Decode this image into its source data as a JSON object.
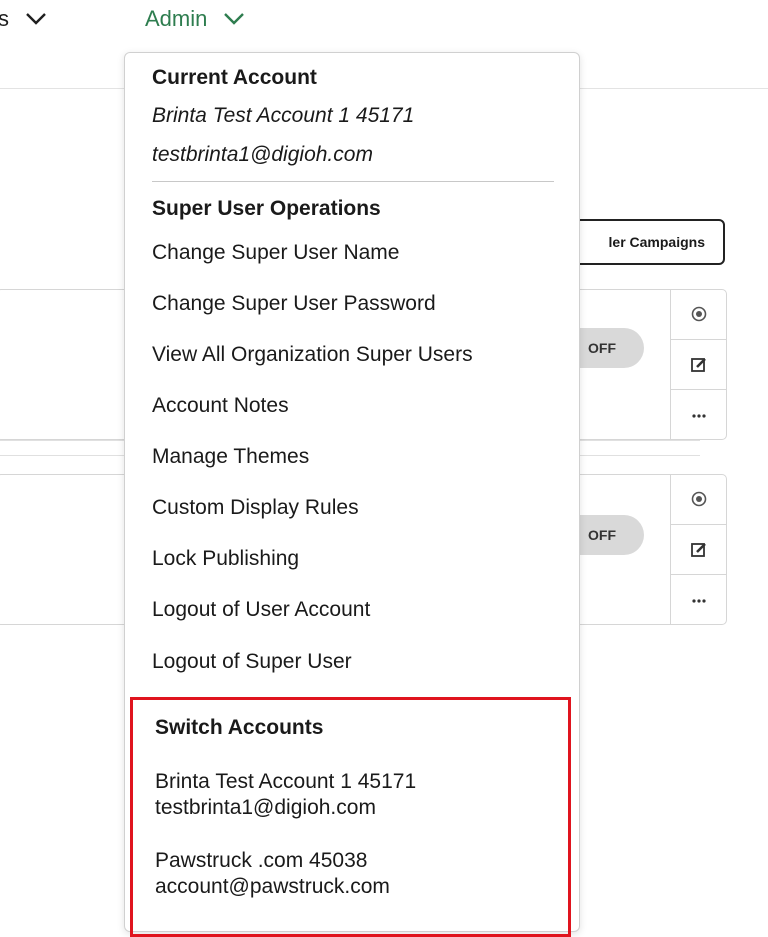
{
  "nav": {
    "left_label": "s",
    "admin_label": "Admin"
  },
  "background": {
    "campaigns_button": "ler Campaigns",
    "card1_toggle": "OFF",
    "card2_toggle": "OFF"
  },
  "dropdown": {
    "current_account_heading": "Current Account",
    "current_account_name": "Brinta Test Account 1 45171",
    "current_account_email": "testbrinta1@digioh.com",
    "super_user_heading": "Super User Operations",
    "items": [
      "Change Super User Name",
      "Change Super User Password",
      "View All Organization Super Users",
      "Account Notes",
      "Manage Themes",
      "Custom Display Rules",
      "Lock Publishing",
      "Logout of User Account",
      "Logout of Super User"
    ],
    "switch_heading": "Switch Accounts",
    "switch_accounts": [
      {
        "name": "Brinta Test Account 1 45171",
        "email": "testbrinta1@digioh.com"
      },
      {
        "name": "Pawstruck .com 45038",
        "email": "account@pawstruck.com"
      }
    ]
  },
  "colors": {
    "admin_green": "#2e7d4f",
    "highlight_red": "#e0141e"
  }
}
